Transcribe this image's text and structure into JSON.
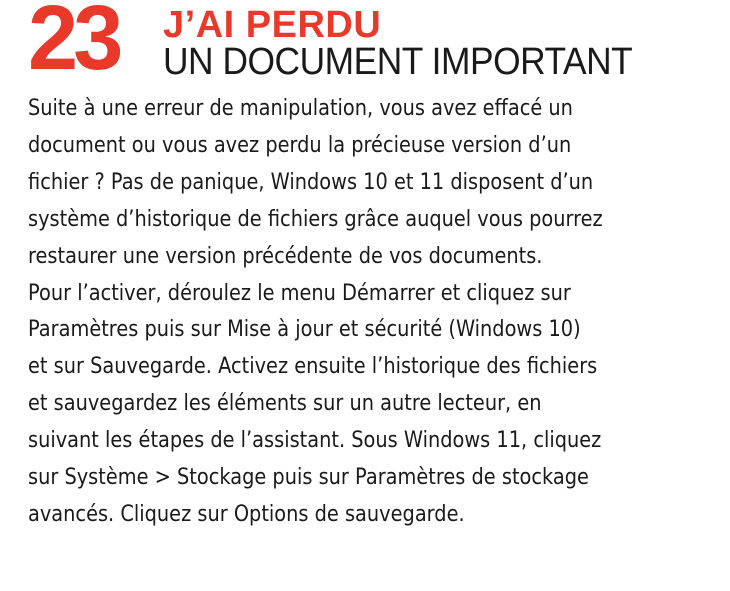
{
  "tip": {
    "number": "23",
    "title_line1": "J’AI PERDU",
    "title_line2": "UN DOCUMENT IMPORTANT"
  },
  "body_lines": [
    "Suite à une erreur de manipulation, vous avez effacé un",
    "document ou vous avez perdu la précieuse version d’un",
    "fichier ? Pas de panique, Windows 10 et 11 disposent d’un",
    "système d’historique de fichiers grâce auquel vous pourrez",
    "restaurer une version précédente de vos documents.",
    "Pour l’activer, déroulez le menu Démarrer et cliquez sur",
    "Paramètres puis sur Mise à jour et sécurité (Windows 10)",
    "et sur Sauvegarde. Activez ensuite l’historique des fichiers",
    "et sauvegardez les éléments sur un autre lecteur, en",
    "suivant les étapes de l’assistant. Sous Windows 11, cliquez",
    "sur Système > Stockage puis sur Paramètres de stockage",
    "avancés. Cliquez sur Options de sauvegarde."
  ],
  "colors": {
    "accent": "#e8392b",
    "text": "#1a1a1a",
    "background": "#ffffff"
  }
}
